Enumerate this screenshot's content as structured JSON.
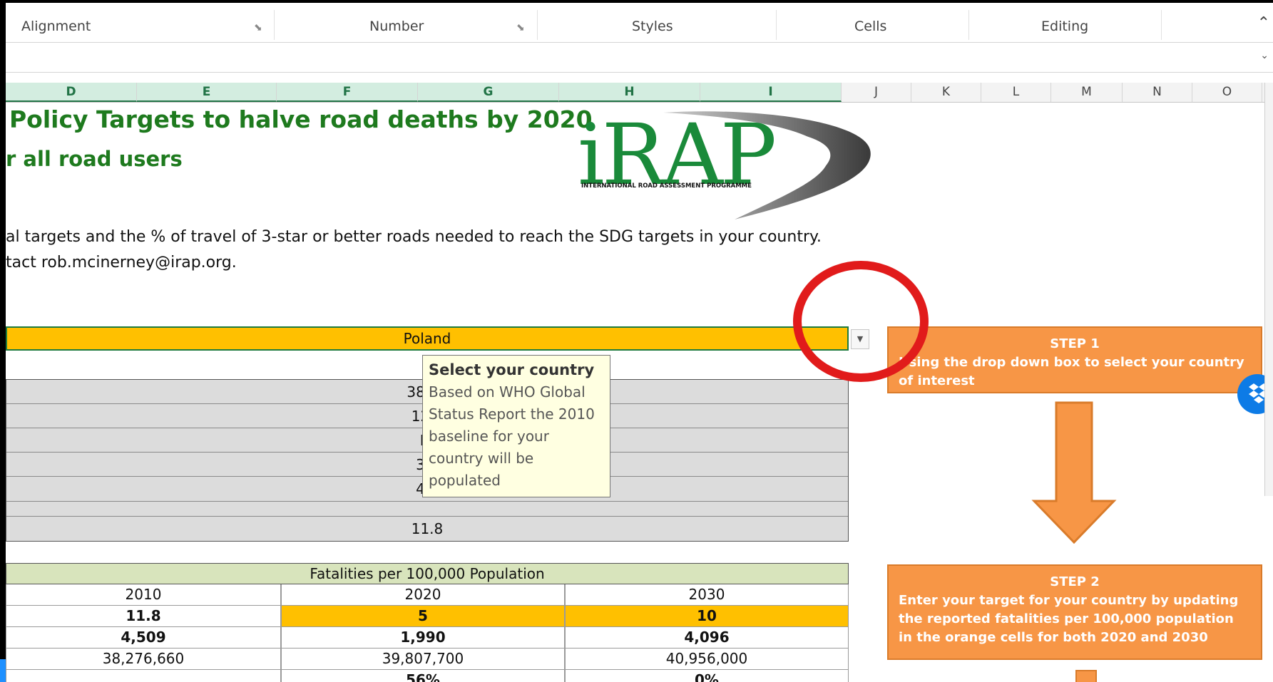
{
  "ribbon": {
    "groups": [
      "Alignment",
      "Number",
      "Styles",
      "Cells",
      "Editing"
    ],
    "collapse_icon": "chevron-up-icon"
  },
  "columns": [
    "D",
    "E",
    "F",
    "G",
    "H",
    "I",
    "J",
    "K",
    "L",
    "M",
    "N",
    "O"
  ],
  "sheet": {
    "title1": "Policy Targets to halve road deaths by 2020",
    "title2": "r all road users",
    "desc1": "al targets and the % of travel of 3-star or better roads needed to reach the SDG targets in your country.",
    "desc2": "tact rob.mcinerney@irap.org.",
    "logo_text": "iRAP",
    "logo_sub": "INTERNATIONAL ROAD ASSESSMENT PROGRAMME",
    "country": "Poland",
    "info_rows": [
      "38,27",
      "12,4",
      "Hi",
      "3,9",
      "4,5",
      "",
      "11.8"
    ]
  },
  "tooltip": {
    "title": "Select your country",
    "body": "Based on WHO Global Status Report the 2010 baseline for your country will be populated"
  },
  "fatalities_table": {
    "header": "Fatalities per 100,000 Population",
    "years": [
      "2010",
      "2020",
      "2030"
    ],
    "rates": [
      "11.8",
      "5",
      "10"
    ],
    "deaths": [
      "4,509",
      "1,990",
      "4,096"
    ],
    "population": [
      "38,276,660",
      "39,807,700",
      "40,956,000"
    ],
    "partial": [
      "",
      "56%",
      "0%"
    ]
  },
  "steps": {
    "step1_title": "STEP 1",
    "step1_text": "Using the drop down box to select your country of interest",
    "step2_title": "STEP 2",
    "step2_text": "Enter your target for your country by updating the reported fatalities per 100,000 population in the orange cells for both 2020 and 2030"
  },
  "colors": {
    "title_green": "#1e7a1e",
    "country_fill": "#ffc000",
    "step_orange": "#f79646",
    "highlight_red": "#e11b1b"
  }
}
